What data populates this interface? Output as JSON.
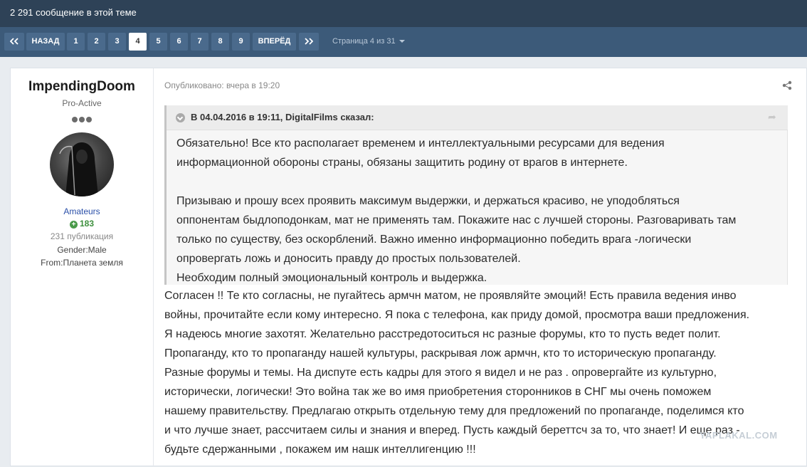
{
  "topbar": {
    "post_count": "2 291 сообщение в этой теме"
  },
  "pagination": {
    "prev_label": "НАЗАД",
    "next_label": "ВПЕРЁД",
    "pages": [
      "1",
      "2",
      "3",
      "4",
      "5",
      "6",
      "7",
      "8",
      "9"
    ],
    "current_page": "4",
    "page_info": "Страница 4 из 31"
  },
  "author": {
    "name": "ImpendingDoom",
    "rank": "Pro-Active",
    "group": "Amateurs",
    "reputation": "183",
    "publications": "231 публикация",
    "gender": "Gender:Male",
    "from": "From:Планета земля"
  },
  "post": {
    "published": "Опубликовано: вчера в 19:20",
    "quote_header": "В 04.04.2016 в 19:11, DigitalFilms сказал:",
    "quote_text": "Обязательно! Все кто располагает временем и интеллектуальными ресурсами для ведения\nинформационной обороны страны, обязаны защитить родину от врагов в интернете.\n\nПризываю и прошу всех проявить максимум выдержки, и держаться красиво, не уподобляться\nоппонентам быдлоподонкам, мат не применять там. Покажите нас с лучшей стороны. Разговаривать там\nтолько по существу, без оскорблений. Важно именно информационно победить врага -логически\nопровергать ложь и доносить правду до простых пользователей.\nНеобходим полный эмоциональный контроль и выдержка.",
    "body_text": "Согласен !! Те кто согласны, не пугайтесь армчн матом, не проявляйте эмоций! Есть правила ведения инво\nвойны, прочитайте если кому интересно. Я пока с телефона, как приду домой, просмотра ваши предложения.\nЯ надеюсь многие захотят. Желательно расстредотоситься нс разные форумы, кто то пусть ведет полит.\nПропаганду, кто то пропаганду нашей культуры, раскрывая лож армчн, кто то историческую пропаганду.\nРазные форумы и темы. На диспуте есть кадры для этого я видел и не раз . опровергайте из культурно,\nисторически, логически! Это война так же во имя приобретения сторонников в СНГ мы очень поможем\nнашему правительству. Предлагаю открыть отдельную тему для предложений по пропаганде, поделимся кто\nи что лучше знает, рассчитаем силы и знания и вперед. Пусть каждый береттсч за то, что знает! И еще раз -\nбудьте сдержанными , покажем им нашк интеллигенцию !!!"
  },
  "watermark": "YAPLAKAL.COM",
  "colors": {
    "topbar": "#2e4257",
    "pagebar": "#3c5a79",
    "active_page": "#ffffff"
  },
  "icons": [
    "double-chevron-left-icon",
    "double-chevron-right-icon",
    "share-icon",
    "quote-toggle-icon",
    "quote-link-icon",
    "caret-down-icon",
    "plus-circle-icon"
  ]
}
